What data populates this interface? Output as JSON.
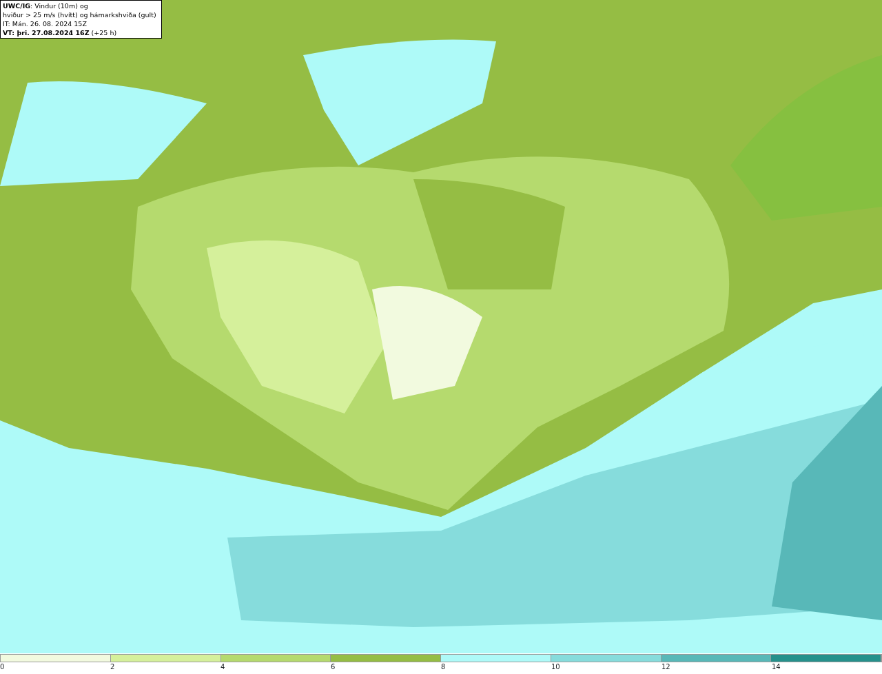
{
  "legend": {
    "lines": [
      "**UWC/IG**: Vindur (10m) og",
      "hviður > 25 m/s (hvítt) og hámarkshviða (gult)",
      "IT: Mán. 26. 08. 2024 15Z",
      "**VT: þri. 27.08.2024 16Z** (+25 h)"
    ]
  },
  "colorbar": {
    "bins": [
      {
        "color": "#f2fadf"
      },
      {
        "color": "#d5f09b"
      },
      {
        "color": "#b5da6e"
      },
      {
        "color": "#95bd44"
      },
      {
        "color": "#aefaf8"
      },
      {
        "color": "#86dcdc"
      },
      {
        "color": "#58b8b8"
      },
      {
        "color": "#26918c"
      }
    ],
    "ticks": [
      "0",
      "2",
      "4",
      "6",
      "8",
      "10",
      "12",
      "14"
    ]
  }
}
